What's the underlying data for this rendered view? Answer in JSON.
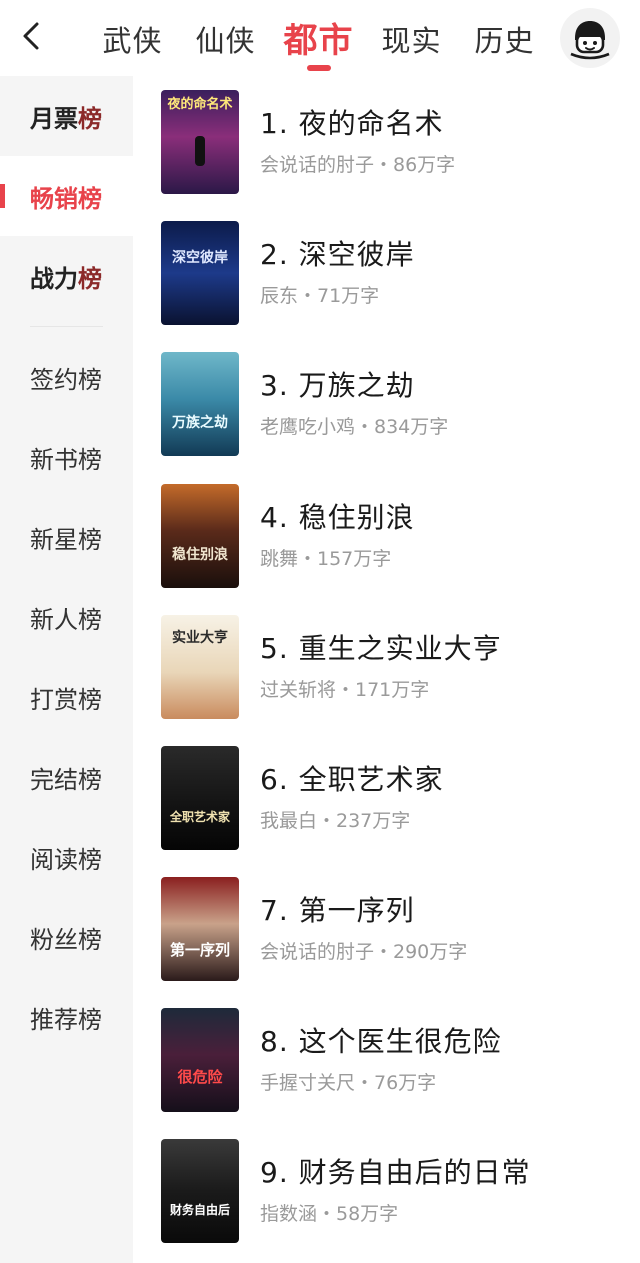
{
  "nav": {
    "back_icon": "chevron-left-icon",
    "tabs": [
      {
        "label": "武侠",
        "active": false
      },
      {
        "label": "仙侠",
        "active": false
      },
      {
        "label": "都市",
        "active": true
      },
      {
        "label": "现实",
        "active": false
      },
      {
        "label": "历史",
        "active": false
      }
    ],
    "avatar_icon": "avatar-face-icon",
    "accent_color": "#e8434b"
  },
  "sidebar": {
    "items": [
      {
        "label": "月票",
        "suffix": "榜"
      },
      {
        "label": "畅销",
        "suffix": "榜",
        "selected": true
      },
      {
        "label": "战力",
        "suffix": "榜"
      },
      {
        "label": "签约榜"
      },
      {
        "label": "新书榜"
      },
      {
        "label": "新星榜"
      },
      {
        "label": "新人榜"
      },
      {
        "label": "打赏榜"
      },
      {
        "label": "完结榜"
      },
      {
        "label": "阅读榜"
      },
      {
        "label": "粉丝榜"
      },
      {
        "label": "推荐榜"
      }
    ]
  },
  "books": [
    {
      "title": "1. 夜的命名术",
      "meta": "会说话的肘子・86万字",
      "cover_text": "夜的命名术"
    },
    {
      "title": "2. 深空彼岸",
      "meta": "辰东・71万字",
      "cover_text": "深空彼岸"
    },
    {
      "title": "3. 万族之劫",
      "meta": "老鹰吃小鸡・834万字",
      "cover_text": "万族之劫"
    },
    {
      "title": "4. 稳住别浪",
      "meta": "跳舞・157万字",
      "cover_text": "稳住别浪"
    },
    {
      "title": "5. 重生之实业大亨",
      "meta": "过关斩将・171万字",
      "cover_text": "实业大亨"
    },
    {
      "title": "6. 全职艺术家",
      "meta": "我最白・237万字",
      "cover_text": "全职艺术家"
    },
    {
      "title": "7. 第一序列",
      "meta": "会说话的肘子・290万字",
      "cover_text": "第一序列"
    },
    {
      "title": "8. 这个医生很危险",
      "meta": "手握寸关尺・76万字",
      "cover_text": "很危险"
    },
    {
      "title": "9. 财务自由后的日常",
      "meta": "指数涵・58万字",
      "cover_text": "财务自由后"
    }
  ]
}
